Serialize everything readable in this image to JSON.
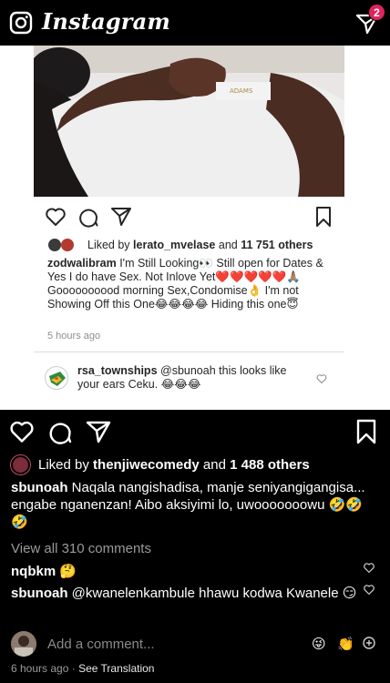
{
  "app": {
    "title": "Instagram",
    "notification_count": "2"
  },
  "embedded_post": {
    "liked_by_user": "lerato_mvelase",
    "liked_by_prefix": "Liked by",
    "liked_by_and": "and",
    "liked_by_count": "11 751 others",
    "author": "zodwalibram",
    "caption": "I'm Still Looking👀 Still open for Dates & Yes I do have Sex. Not Inlove Yet❤️❤️❤️❤️❤️🙏🏽 Goooooooood morning Sex,Condomise👌 I'm not Showing Off this One😂😂😂😂 Hiding this one😇",
    "time": "5 hours ago",
    "comment_user": "rsa_townships",
    "comment_text": "@sbunoah this looks like your ears Ceku. 😂😂😂"
  },
  "post": {
    "liked_by_prefix": "Liked by",
    "liked_by_user": "thenjiwecomedy",
    "liked_by_and": "and",
    "liked_by_count": "1 488 others",
    "author": "sbunoah",
    "caption": "Naqala nangishadisa, manje seniyangigangisa... engabe nganenzan! Aibo aksiyimi lo, uwooooooowu 🤣🤣🤣",
    "view_all": "View all 310 comments",
    "comments": [
      {
        "user": "nqbkm",
        "text": "🤔"
      },
      {
        "user": "sbunoah",
        "text": "@kwanelenkambule hhawu kodwa Kwanele 😏"
      }
    ],
    "add_comment_placeholder": "Add a comment...",
    "quick_reactions": [
      "😜",
      "👏"
    ],
    "time": "6 hours ago",
    "see_translation": "See Translation",
    "separator": "·"
  }
}
